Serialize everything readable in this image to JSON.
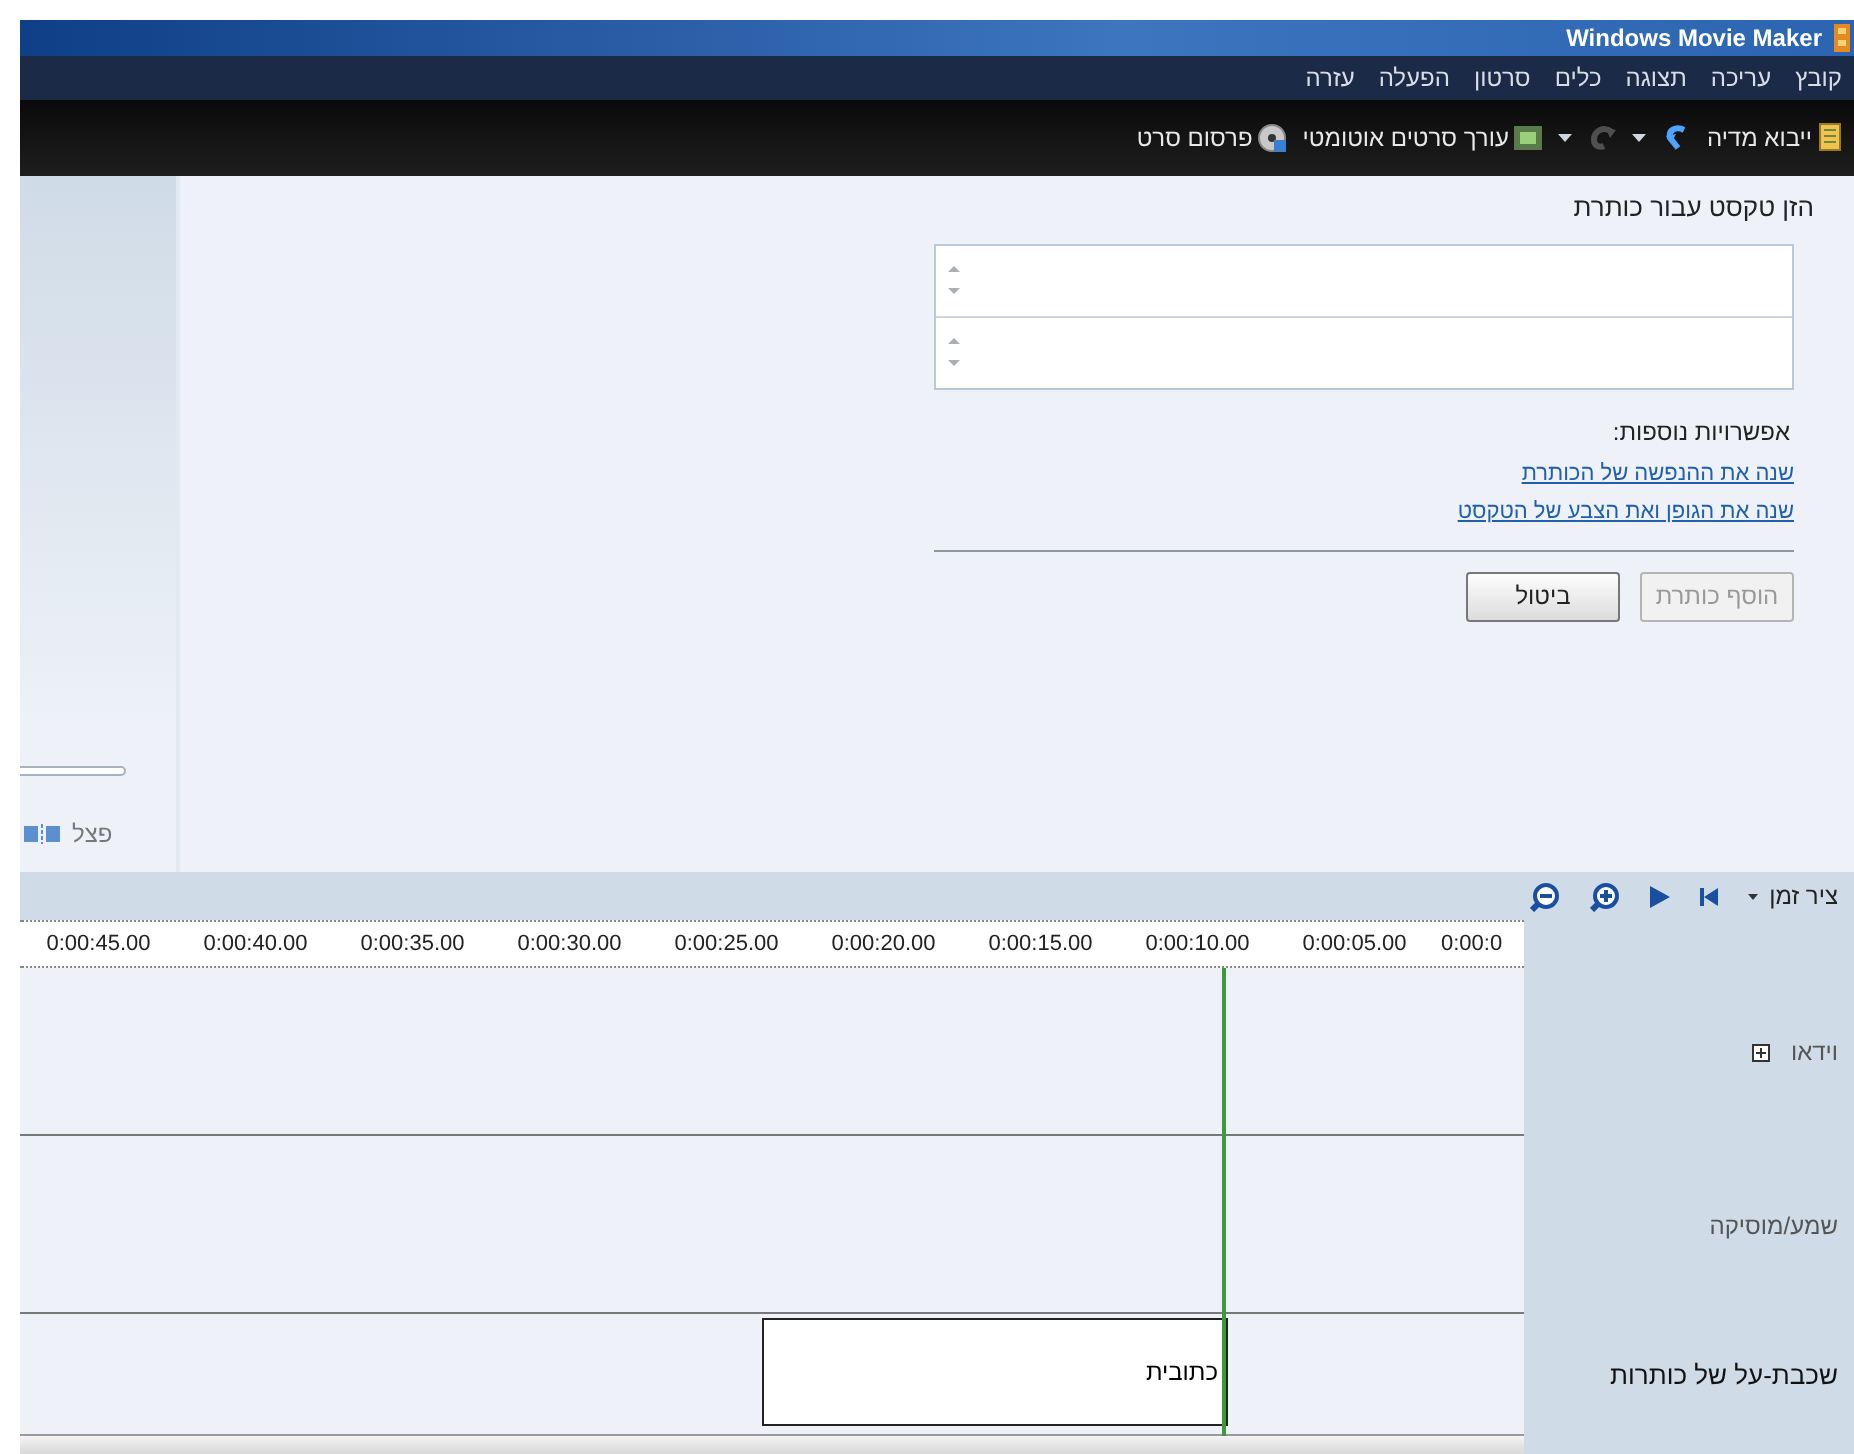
{
  "window": {
    "title": "Windows Movie Maker"
  },
  "menu": [
    "קובץ",
    "עריכה",
    "תצוגה",
    "כלים",
    "סרטון",
    "הפעלה",
    "עזרה"
  ],
  "toolbar": [
    {
      "kind": "import",
      "label": "ייבוא מדיה",
      "disabled": false
    },
    {
      "kind": "undo",
      "disabled": false
    },
    {
      "kind": "redo",
      "disabled": true
    },
    {
      "kind": "automovie",
      "label": "עורך סרטים אוטומטי",
      "disabled": false
    },
    {
      "kind": "publish",
      "label": "פרסום סרט",
      "disabled": false
    }
  ],
  "preview": {
    "split_label": "פצל"
  },
  "task": {
    "heading": "הזן טקסט עבור כותרת",
    "options_label": "אפשרויות נוספות:",
    "links": [
      "שנה את ההנפשה של הכותרת",
      "שנה את הגופן ואת הצבע של הטקסט"
    ],
    "buttons": [
      {
        "label": "הוסף כותרת",
        "disabled": true
      },
      {
        "label": "ביטול",
        "disabled": false
      }
    ]
  },
  "timeline": {
    "view_label": "ציר זמן",
    "ruler": [
      "0:00:0",
      "0:00:05.00",
      "0:00:10.00",
      "0:00:15.00",
      "0:00:20.00",
      "0:00:25.00",
      "0:00:30.00",
      "0:00:35.00",
      "0:00:40.00",
      "0:00:45.00"
    ],
    "tracks": [
      {
        "kind": "video",
        "label": "וידאו",
        "expanded": false,
        "selected": false
      },
      {
        "kind": "audio",
        "label": "שמע/מוסיקה",
        "selected": false
      },
      {
        "kind": "titles",
        "label": "שכבת-על של כותרות",
        "selected": true,
        "clip": "כתובית"
      }
    ]
  }
}
